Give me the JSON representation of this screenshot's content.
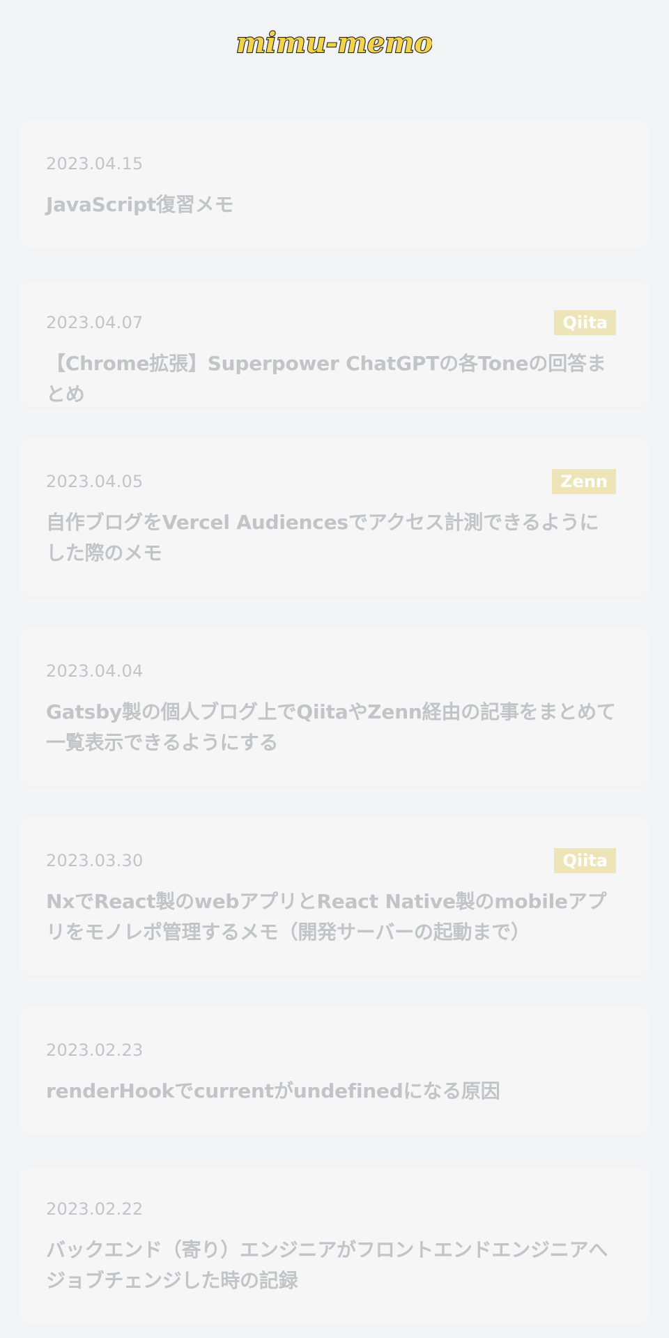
{
  "site": {
    "logo_text": "mimu-memo",
    "colors": {
      "page_background": "#f3f4f6",
      "card_background": "#f6f6f7",
      "muted_text": "#c3c4c8",
      "logo_fill": "#f2d34b",
      "logo_outline": "#1f1f1f"
    }
  },
  "posts": [
    {
      "date": "2023.04.15",
      "title": "JavaScript復習メモ",
      "badge": "",
      "badge_color": ""
    },
    {
      "date": "2023.04.07",
      "title": "【Chrome拡張】Superpower ChatGPTの各Toneの回答まとめ",
      "badge": "Qiita",
      "badge_color": "#ede5b8"
    },
    {
      "date": "2023.04.05",
      "title": "自作ブログをVercel Audiencesでアクセス計測できるようにした際のメモ",
      "badge": "Zenn",
      "badge_color": "#ede5b8"
    },
    {
      "date": "2023.04.04",
      "title": "Gatsby製の個人ブログ上でQiitaやZenn経由の記事をまとめて一覧表示できるようにする",
      "badge": "",
      "badge_color": ""
    },
    {
      "date": "2023.03.30",
      "title": "NxでReact製のwebアプリとReact Native製のmobileアプリをモノレポ管理するメモ（開発サーバーの起動まで）",
      "badge": "Qiita",
      "badge_color": "#ede5b8"
    },
    {
      "date": "2023.02.23",
      "title": "renderHookでcurrentがundefinedになる原因",
      "badge": "",
      "badge_color": ""
    },
    {
      "date": "2023.02.22",
      "title": "バックエンド（寄り）エンジニアがフロントエンドエンジニアへジョブチェンジした時の記録",
      "badge": "",
      "badge_color": ""
    }
  ]
}
